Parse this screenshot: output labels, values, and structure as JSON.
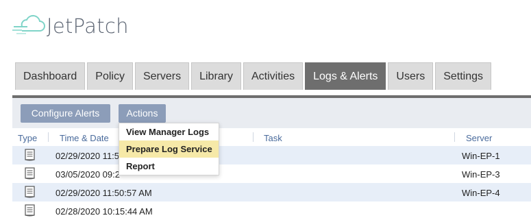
{
  "brand": {
    "name": "JetPatch"
  },
  "tabs": [
    {
      "label": "Dashboard"
    },
    {
      "label": "Policy"
    },
    {
      "label": "Servers"
    },
    {
      "label": "Library"
    },
    {
      "label": "Activities"
    },
    {
      "label": "Logs & Alerts",
      "active": true
    },
    {
      "label": "Users"
    },
    {
      "label": "Settings"
    }
  ],
  "toolbar": {
    "configure_label": "Configure Alerts",
    "actions_label": "Actions"
  },
  "table": {
    "headers": {
      "type": "Type",
      "time": "Time & Date",
      "task": "Task",
      "server": "Server"
    },
    "rows": [
      {
        "time": "02/29/2020 11:5",
        "server": "Win-EP-1"
      },
      {
        "time": "03/05/2020 09:2",
        "server": "Win-EP-3"
      },
      {
        "time": "02/29/2020 11:50:57 AM",
        "server": "Win-EP-4"
      },
      {
        "time": "02/28/2020 10:15:44 AM",
        "server": ""
      }
    ]
  },
  "menu": {
    "items": [
      {
        "label": "View Manager Logs"
      },
      {
        "label": "Prepare Log Service",
        "highlighted": true
      },
      {
        "label": "Report"
      }
    ]
  },
  "colors": {
    "accent": "#8c9db9",
    "active_tab": "#6e6e6e",
    "row_alt": "#e7eef8",
    "highlight": "#f6e9a8"
  }
}
